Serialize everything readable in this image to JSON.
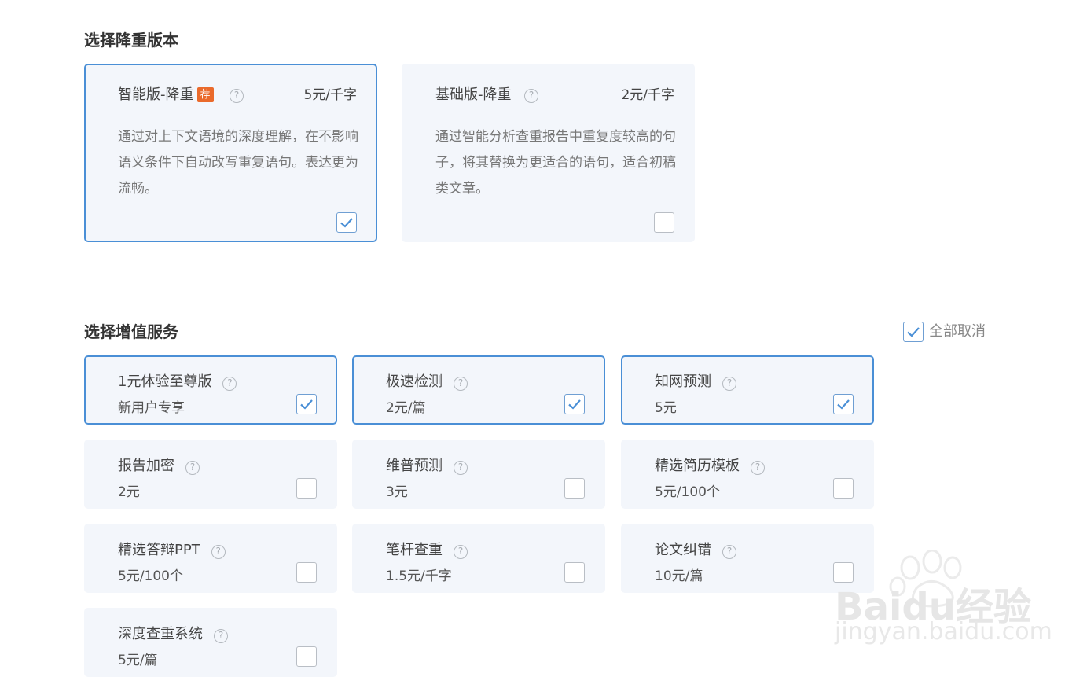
{
  "version_section": {
    "title": "选择降重版本",
    "cards": [
      {
        "name": "智能版-降重",
        "badge": "荐",
        "help": "?",
        "price": "5元/千字",
        "description": "通过对上下文语境的深度理解，在不影响语义条件下自动改写重复语句。表达更为流畅。",
        "selected": true
      },
      {
        "name": "基础版-降重",
        "help": "?",
        "price": "2元/千字",
        "description": "通过智能分析查重报告中重复度较高的句子，将其替换为更适合的语句，适合初稿类文章。",
        "selected": false
      }
    ]
  },
  "service_section": {
    "title": "选择增值服务",
    "cancel_all_label": "全部取消",
    "cancel_all_checked": true,
    "help": "?",
    "items": [
      {
        "name": "1元体验至尊版",
        "price": "新用户专享",
        "checked": true
      },
      {
        "name": "极速检测",
        "price": "2元/篇",
        "checked": true
      },
      {
        "name": "知网预测",
        "price": "5元",
        "checked": true
      },
      {
        "name": "报告加密",
        "price": "2元",
        "checked": false
      },
      {
        "name": "维普预测",
        "price": "3元",
        "checked": false
      },
      {
        "name": "精选简历模板",
        "price": "5元/100个",
        "checked": false
      },
      {
        "name": "精选答辩PPT",
        "price": "5元/100个",
        "checked": false
      },
      {
        "name": "笔杆查重",
        "price": "1.5元/千字",
        "checked": false
      },
      {
        "name": "论文纠错",
        "price": "10元/篇",
        "checked": false
      },
      {
        "name": "深度查重系统",
        "price": "5元/篇",
        "checked": false
      }
    ]
  },
  "watermark": {
    "brand": "Baidu经验",
    "url": "jingyan.baidu.com"
  },
  "colors": {
    "accent": "#4a8fd6",
    "badge": "#ea6a2b",
    "card_bg": "#f3f6fb"
  }
}
